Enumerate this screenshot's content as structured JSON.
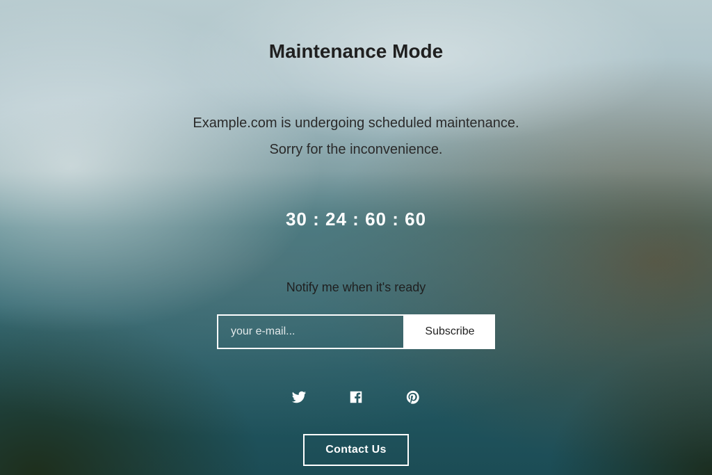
{
  "heading": "Maintenance Mode",
  "message": {
    "line1": "Example.com is undergoing scheduled maintenance.",
    "line2": "Sorry for the inconvenience."
  },
  "countdown": {
    "days": "30",
    "hours": "24",
    "minutes": "60",
    "seconds": "60",
    "separator": ":"
  },
  "notify_label": "Notify me when it's ready",
  "email": {
    "placeholder": "your e-mail..."
  },
  "subscribe_label": "Subscribe",
  "social": {
    "twitter": "twitter-icon",
    "facebook": "facebook-icon",
    "pinterest": "pinterest-icon"
  },
  "contact_label": "Contact Us"
}
